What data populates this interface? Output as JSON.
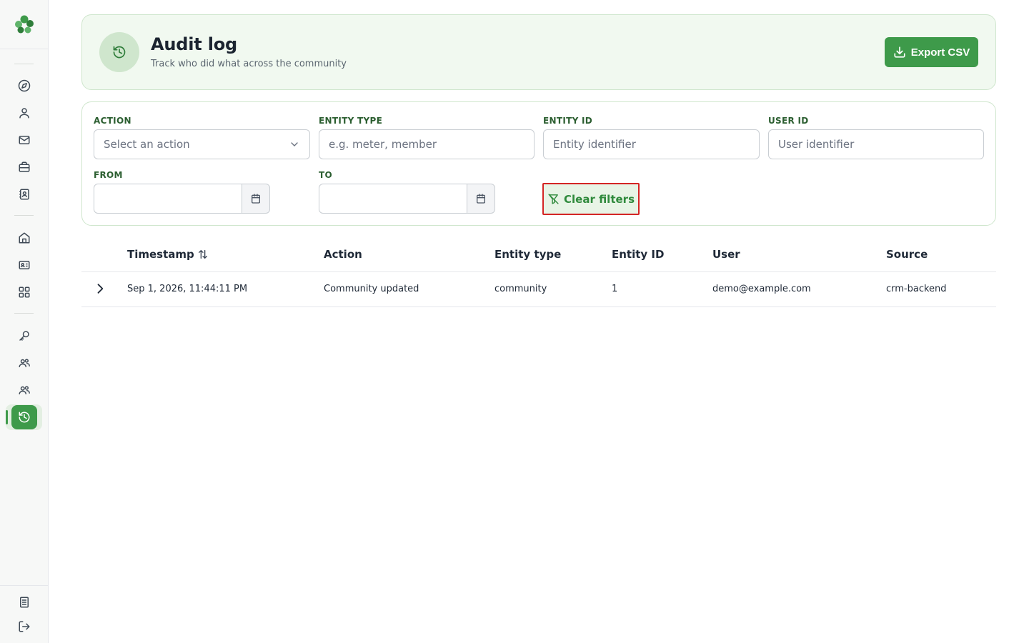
{
  "sidebar": {
    "items": [
      {
        "name": "compass-icon"
      },
      {
        "name": "user-icon"
      },
      {
        "name": "mail-icon"
      },
      {
        "name": "briefcase-icon"
      },
      {
        "name": "contact-book-icon"
      },
      {
        "name": "home-icon"
      },
      {
        "name": "id-card-icon"
      },
      {
        "name": "grid-icon"
      },
      {
        "name": "key-icon"
      },
      {
        "name": "users-icon"
      },
      {
        "name": "users-alt-icon"
      },
      {
        "name": "history-icon",
        "active": true
      }
    ],
    "bottom_items": [
      {
        "name": "document-icon"
      },
      {
        "name": "logout-icon"
      }
    ],
    "accent_color": "#3e9a4a"
  },
  "header": {
    "title": "Audit log",
    "subtitle": "Track who did what across the community",
    "export_label": "Export CSV"
  },
  "filters": {
    "action": {
      "label": "ACTION",
      "placeholder": "Select an action"
    },
    "entity_type": {
      "label": "ENTITY TYPE",
      "placeholder": "e.g. meter, member"
    },
    "entity_id": {
      "label": "ENTITY ID",
      "placeholder": "Entity identifier"
    },
    "user_id": {
      "label": "USER ID",
      "placeholder": "User identifier"
    },
    "from": {
      "label": "FROM",
      "value": ""
    },
    "to": {
      "label": "TO",
      "value": ""
    },
    "clear_label": "Clear filters"
  },
  "table": {
    "columns": [
      "Timestamp",
      "Action",
      "Entity type",
      "Entity ID",
      "User",
      "Source"
    ],
    "rows": [
      {
        "timestamp": "Sep 1, 2026, 11:44:11 PM",
        "action": "Community updated",
        "entity_type": "community",
        "entity_id": "1",
        "user": "demo@example.com",
        "source": "crm-backend"
      }
    ]
  }
}
